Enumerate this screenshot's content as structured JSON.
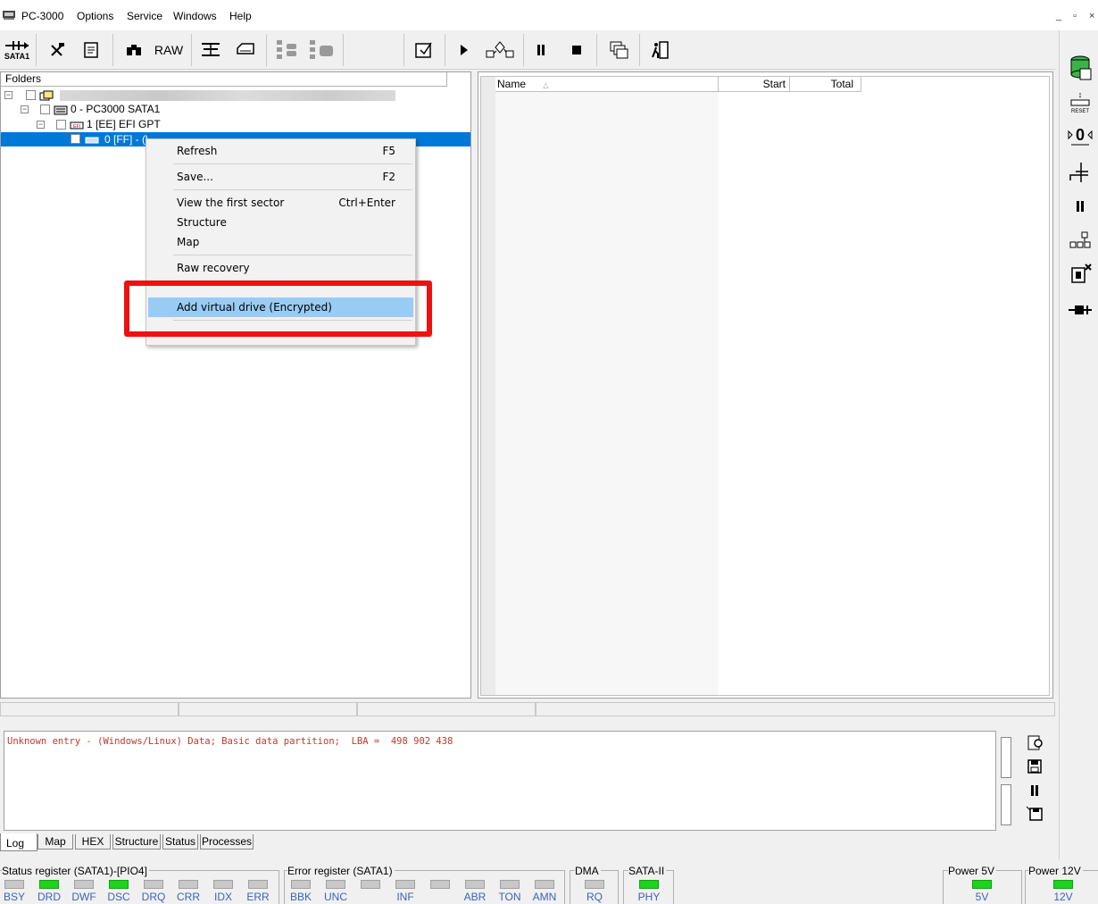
{
  "menubar": {
    "app_name": "PC-3000",
    "items": [
      "Options",
      "Service",
      "Windows",
      "Help"
    ],
    "window_controls": [
      "_",
      "▫",
      "×"
    ]
  },
  "toolbar": {
    "sata_label": "SATA1",
    "raw_label": "RAW"
  },
  "folders": {
    "header": "Folders",
    "nodes": [
      {
        "label": "0 - PC3000 SATA1"
      },
      {
        "label": "1 [EE] EFI GPT"
      },
      {
        "label": "0 [FF] - (Windows/Linux) Data - Basic data partition"
      }
    ]
  },
  "context_menu": {
    "items": [
      {
        "label": "Refresh",
        "shortcut": "F5"
      },
      {
        "label": "Save...",
        "shortcut": "F2"
      },
      {
        "label": "View the first sector",
        "shortcut": "Ctrl+Enter"
      },
      {
        "label": "Structure",
        "shortcut": ""
      },
      {
        "label": "Map",
        "shortcut": ""
      },
      {
        "label": "Raw recovery",
        "shortcut": ""
      },
      {
        "label": "Add virtual drive (Encrypted)",
        "shortcut": ""
      }
    ]
  },
  "list": {
    "columns": [
      "Name",
      "Start",
      "Total"
    ]
  },
  "log": {
    "text": "Unknown entry - (Windows/Linux) Data; Basic data partition;  LBA =  498 902 438"
  },
  "tabs": [
    "Log",
    "Map",
    "HEX",
    "Structure",
    "Status",
    "Processes"
  ],
  "status": {
    "status_register_title": "Status register (SATA1)-[PIO4]",
    "status_register": [
      {
        "label": "BSY",
        "on": false
      },
      {
        "label": "DRD",
        "on": true
      },
      {
        "label": "DWF",
        "on": false
      },
      {
        "label": "DSC",
        "on": true
      },
      {
        "label": "DRQ",
        "on": false
      },
      {
        "label": "CRR",
        "on": false
      },
      {
        "label": "IDX",
        "on": false
      },
      {
        "label": "ERR",
        "on": false
      }
    ],
    "error_register_title": "Error register (SATA1)",
    "error_register": [
      {
        "label": "BBK",
        "on": false
      },
      {
        "label": "UNC",
        "on": false
      },
      {
        "label": "",
        "on": false
      },
      {
        "label": "INF",
        "on": false
      },
      {
        "label": "",
        "on": false
      },
      {
        "label": "ABR",
        "on": false
      },
      {
        "label": "TON",
        "on": false
      },
      {
        "label": "AMN",
        "on": false
      }
    ],
    "dma_title": "DMA",
    "dma": {
      "label": "RQ",
      "on": false
    },
    "sata2_title": "SATA-II",
    "sata2": {
      "label": "PHY",
      "on": true
    },
    "power5_title": "Power 5V",
    "power5": {
      "label": "5V",
      "on": true
    },
    "power12_title": "Power 12V",
    "power12": {
      "label": "12V",
      "on": true
    }
  },
  "colors": {
    "selection": "#0078d7",
    "menu_highlight": "#99ccf5",
    "annotation_box": "#ee1111",
    "led_on": "#1ed31e",
    "log_text": "#c0392b"
  }
}
